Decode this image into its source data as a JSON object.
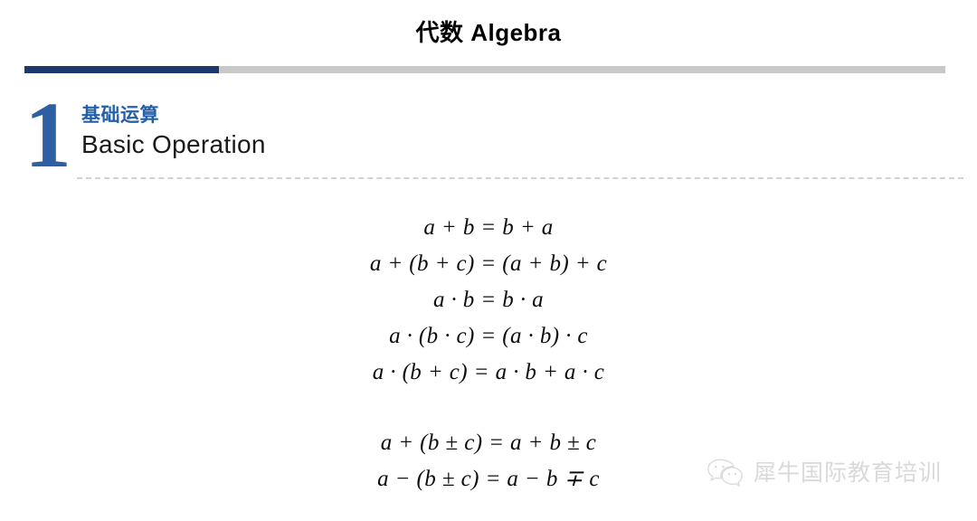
{
  "slide": {
    "title": "代数 Algebra",
    "background_color": "#ffffff"
  },
  "accent_bar": {
    "fill_color": "#1b3a6b",
    "track_color": "#c9c9c9",
    "fill_percent": 21
  },
  "section": {
    "number": "1",
    "number_color": "#2E5FA3",
    "title_cn": "基础运算",
    "title_cn_color": "#2560A8",
    "title_en": "Basic Operation",
    "title_en_color": "#1a1a1a"
  },
  "divider": {
    "style": "dashed",
    "color": "#d2d2d2"
  },
  "formulas": {
    "group_1": [
      "a + b = b + a",
      "a + (b + c) = (a + b) + c",
      "a · b = b · a",
      "a · (b · c) = (a · b) · c",
      "a · (b + c) = a · b + a · c"
    ],
    "group_2": [
      "a + (b ± c) = a + b ± c",
      "a − (b ± c) = a − b ∓ c"
    ]
  },
  "watermark": {
    "icon": "wechat-icon",
    "text": "犀牛国际教育培训",
    "color": "#d8d8d8"
  }
}
